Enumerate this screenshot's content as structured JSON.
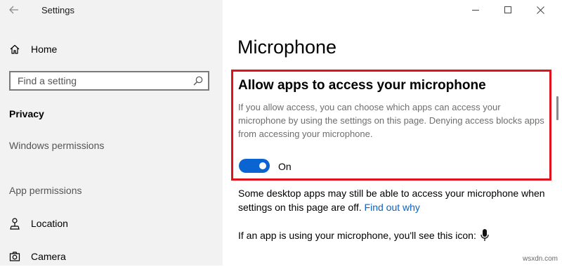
{
  "window": {
    "title": "Settings",
    "controls": [
      "minimize-icon",
      "maximize-icon",
      "close-icon"
    ]
  },
  "sidebar": {
    "home_label": "Home",
    "search_placeholder": "Find a setting",
    "section_title": "Privacy",
    "windows_permissions_label": "Windows permissions",
    "app_permissions_label": "App permissions",
    "items": [
      {
        "label": "Location",
        "icon": "location-pin-icon"
      },
      {
        "label": "Camera",
        "icon": "camera-icon"
      }
    ]
  },
  "main": {
    "page_title": "Microphone",
    "allow_heading": "Allow apps to access your microphone",
    "allow_description": "If you allow access, you can choose which apps can access your microphone by using the settings on this page. Denying access blocks apps from accessing your microphone.",
    "toggle_state": "On",
    "note_text": "Some desktop apps may still be able to access your microphone when settings on this page are off.",
    "find_out_why": "Find out why",
    "icon_note": "If an app is using your microphone, you'll see this icon:"
  },
  "colors": {
    "accent": "#0a64d2",
    "highlight_border": "#e0121b",
    "link": "#0a63c4",
    "sidebar_bg": "#f2f2f2"
  },
  "watermark": "wsxdn.com"
}
